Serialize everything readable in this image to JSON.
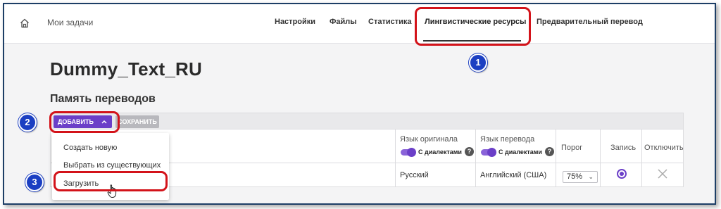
{
  "header": {
    "app_title": "Мои задачи",
    "nav": [
      "Настройки",
      "Файлы",
      "Статистика",
      "Лингвистические ресурсы",
      "Предварительный перевод"
    ]
  },
  "project_title": "Dummy_Text_RU",
  "section_title": "Память переводов",
  "toolbar": {
    "add_label": "ДОБАВИТЬ",
    "save_label": "СОХРАНИТЬ"
  },
  "dropdown": {
    "items": [
      "Создать новую",
      "Выбрать из существующих",
      "Загрузить"
    ]
  },
  "table": {
    "headers": {
      "source_lang": "Язык оригинала",
      "target_lang": "Язык перевода",
      "threshold": "Порог",
      "write": "Запись",
      "disable": "Отключить"
    },
    "dialects_toggle_label": "С диалектами",
    "help_glyph": "?",
    "row": {
      "source_lang": "Русский",
      "target_lang": "Английский (США)",
      "threshold": "75%",
      "write_selected": true
    }
  },
  "callouts": [
    "1",
    "2",
    "3"
  ],
  "colors": {
    "accent": "#6b3fc8",
    "callout_border": "#d3131a",
    "callout_badge": "#1b3fc2"
  }
}
